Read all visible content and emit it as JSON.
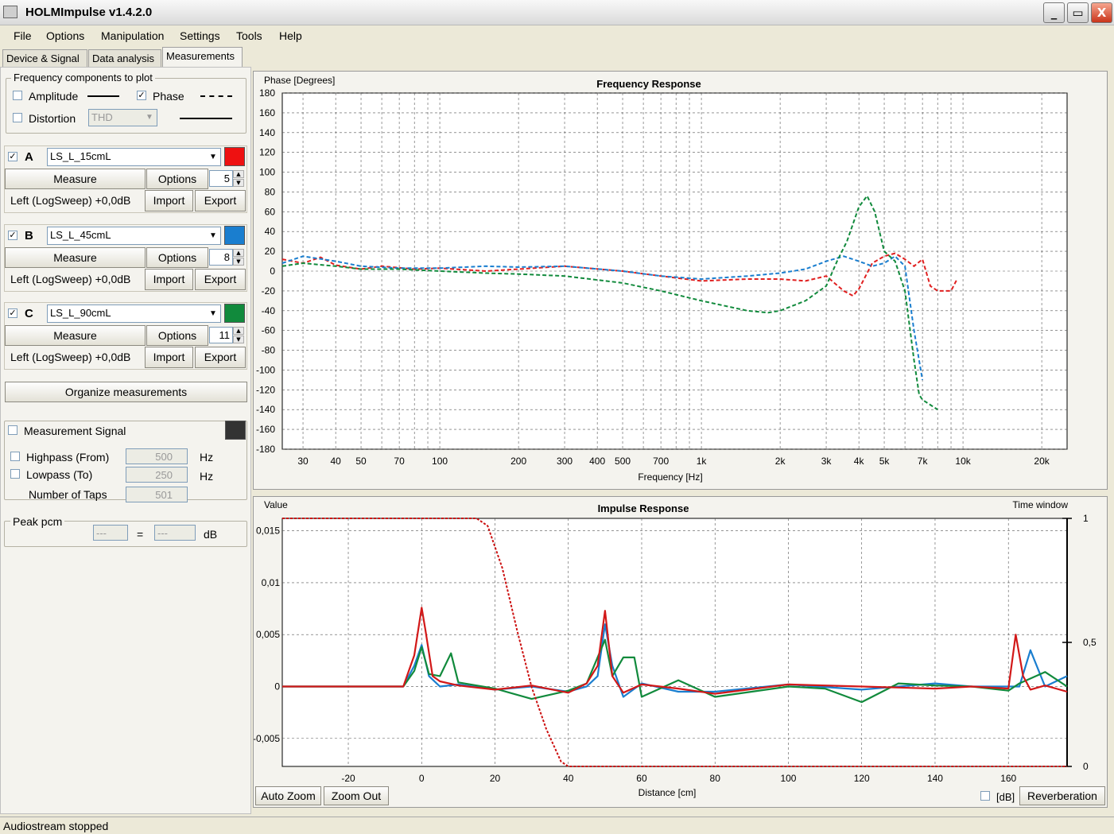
{
  "window": {
    "title": "HOLMImpulse  v1.4.2.0",
    "minimize": "_",
    "maximize": "▭",
    "close": "X"
  },
  "menu": [
    "File",
    "Options",
    "Manipulation",
    "Settings",
    "Tools",
    "Help"
  ],
  "tabs": [
    "Device & Signal",
    "Data analysis",
    "Measurements"
  ],
  "freq_components": {
    "title": "Frequency components to plot",
    "amplitude": "Amplitude",
    "amplitude_checked": false,
    "phase": "Phase",
    "phase_checked": true,
    "distortion": "Distortion",
    "distortion_checked": false,
    "distortion_select": "THD"
  },
  "measurements": [
    {
      "letter": "A",
      "checked": true,
      "name": "LS_L_15cmL",
      "color": "#ee1111",
      "measure": "Measure",
      "options": "Options",
      "spin": "5",
      "info": "Left (LogSweep) +0,0dB",
      "import": "Import",
      "export": "Export"
    },
    {
      "letter": "B",
      "checked": true,
      "name": "LS_L_45cmL",
      "color": "#1a7ecf",
      "measure": "Measure",
      "options": "Options",
      "spin": "8",
      "info": "Left (LogSweep) +0,0dB",
      "import": "Import",
      "export": "Export"
    },
    {
      "letter": "C",
      "checked": true,
      "name": "LS_L_90cmL",
      "color": "#118a3c",
      "measure": "Measure",
      "options": "Options",
      "spin": "11",
      "info": "Left (LogSweep) +0,0dB",
      "import": "Import",
      "export": "Export"
    }
  ],
  "organize": "Organize measurements",
  "signal": {
    "label": "Measurement Signal",
    "checked": false,
    "color": "#333333",
    "highpass": "Highpass (From)",
    "highpass_val": "500",
    "highpass_unit": "Hz",
    "lowpass": "Lowpass (To)",
    "lowpass_val": "250",
    "lowpass_unit": "Hz",
    "taps": "Number of Taps",
    "taps_val": "501"
  },
  "peak": {
    "title": "Peak pcm",
    "val1": "---",
    "eq": "=",
    "val2": "---",
    "unit": "dB"
  },
  "chart_data": [
    {
      "type": "line",
      "title": "Frequency Response",
      "ylabel": "Phase [Degrees]",
      "xlabel": "Frequency [Hz]",
      "xscale": "log",
      "xlim": [
        25,
        25000
      ],
      "ylim": [
        -180,
        180
      ],
      "yticks": [
        180,
        160,
        140,
        120,
        100,
        80,
        60,
        40,
        20,
        0,
        -20,
        -40,
        -60,
        -80,
        -100,
        -120,
        -140,
        -160,
        -180
      ],
      "xticks": [
        [
          30,
          "30"
        ],
        [
          40,
          "40"
        ],
        [
          50,
          "50"
        ],
        [
          70,
          "70"
        ],
        [
          100,
          "100"
        ],
        [
          200,
          "200"
        ],
        [
          300,
          "300"
        ],
        [
          400,
          "400"
        ],
        [
          500,
          "500"
        ],
        [
          700,
          "700"
        ],
        [
          1000,
          "1k"
        ],
        [
          2000,
          "2k"
        ],
        [
          3000,
          "3k"
        ],
        [
          4000,
          "4k"
        ],
        [
          5000,
          "5k"
        ],
        [
          7000,
          "7k"
        ],
        [
          10000,
          "10k"
        ],
        [
          20000,
          "20k"
        ]
      ],
      "grid": true,
      "series": [
        {
          "color": "#e02020",
          "dash": "dashed",
          "x": [
            25,
            30,
            35,
            40,
            50,
            60,
            80,
            100,
            150,
            200,
            300,
            500,
            700,
            1000,
            1500,
            2000,
            2500,
            3000,
            3500,
            3800,
            4000,
            4500,
            5000,
            5500,
            6000,
            6500,
            7000,
            7500,
            8000,
            9000,
            9500
          ],
          "y": [
            12,
            8,
            14,
            6,
            2,
            5,
            2,
            3,
            0,
            2,
            5,
            0,
            -5,
            -10,
            -8,
            -8,
            -10,
            -5,
            -20,
            -25,
            -18,
            8,
            15,
            18,
            12,
            5,
            12,
            -15,
            -20,
            -20,
            -8
          ]
        },
        {
          "color": "#1a7ecf",
          "dash": "dashed",
          "x": [
            25,
            30,
            40,
            50,
            70,
            100,
            150,
            200,
            300,
            500,
            700,
            1000,
            1500,
            2000,
            2500,
            3000,
            3500,
            4000,
            4500,
            5000,
            5500,
            6000,
            6500,
            7000
          ],
          "y": [
            8,
            15,
            10,
            5,
            3,
            3,
            5,
            4,
            5,
            0,
            -5,
            -8,
            -5,
            -2,
            2,
            10,
            15,
            10,
            5,
            8,
            15,
            5,
            -60,
            -110
          ]
        },
        {
          "color": "#118a3c",
          "dash": "dashed",
          "x": [
            25,
            30,
            40,
            50,
            70,
            100,
            150,
            200,
            300,
            500,
            700,
            1000,
            1500,
            1800,
            2000,
            2500,
            3000,
            3300,
            3600,
            4000,
            4300,
            4600,
            5000,
            5500,
            6000,
            6500,
            6800,
            7000,
            8000
          ],
          "y": [
            5,
            8,
            5,
            2,
            2,
            0,
            -2,
            -3,
            -5,
            -12,
            -20,
            -30,
            -40,
            -42,
            -40,
            -30,
            -15,
            10,
            30,
            65,
            76,
            60,
            20,
            10,
            -20,
            -90,
            -125,
            -130,
            -140
          ]
        }
      ]
    },
    {
      "type": "line",
      "title": "Impulse Response",
      "ylabel": "Value",
      "y2label": "Time window",
      "xlabel": "Distance [cm]",
      "xlim": [
        -38,
        176
      ],
      "ylim": [
        -0.0077,
        0.0162
      ],
      "yticks": [
        [
          0.015,
          "0,015"
        ],
        [
          0.01,
          "0,01"
        ],
        [
          0.005,
          "0,005"
        ],
        [
          0,
          "0"
        ],
        [
          -0.005,
          "-0,005"
        ]
      ],
      "y2ticks": [
        [
          1,
          "1"
        ],
        [
          0.5,
          "0,5"
        ],
        [
          0,
          "0"
        ]
      ],
      "xticks": [
        [
          -20,
          "-20"
        ],
        [
          0,
          "0"
        ],
        [
          20,
          "20"
        ],
        [
          40,
          "40"
        ],
        [
          60,
          "60"
        ],
        [
          80,
          "80"
        ],
        [
          100,
          "100"
        ],
        [
          120,
          "120"
        ],
        [
          140,
          "140"
        ],
        [
          160,
          "160"
        ]
      ],
      "grid": true,
      "series": [
        {
          "color": "#1a7ecf",
          "x": [
            -38,
            -5,
            -2,
            0,
            2,
            5,
            10,
            20,
            30,
            40,
            45,
            48,
            50,
            52,
            55,
            60,
            70,
            80,
            100,
            120,
            140,
            150,
            160,
            163,
            166,
            170,
            176
          ],
          "y": [
            0,
            0,
            0.002,
            0.004,
            0.001,
            0,
            0.0002,
            -0.0003,
            0,
            -0.0005,
            0,
            0.001,
            0.006,
            0.002,
            -0.001,
            0.0003,
            -0.0005,
            -0.0005,
            0.0002,
            -0.0003,
            0.0003,
            0,
            0,
            0,
            0.0035,
            0,
            0.001
          ]
        },
        {
          "color": "#118a3c",
          "x": [
            -38,
            -5,
            -2,
            0,
            2,
            5,
            8,
            10,
            20,
            30,
            40,
            45,
            50,
            52,
            55,
            58,
            60,
            70,
            80,
            90,
            100,
            110,
            120,
            130,
            140,
            150,
            160,
            163,
            170,
            176
          ],
          "y": [
            0,
            0,
            0.0015,
            0.0038,
            0.0012,
            0.001,
            0.0032,
            0.0004,
            -0.0002,
            -0.0012,
            -0.0004,
            0.0003,
            0.0045,
            0.001,
            0.0028,
            0.0028,
            -0.001,
            0.0006,
            -0.001,
            -0.0005,
            0,
            -0.0002,
            -0.0015,
            0.0003,
            0.0001,
            0,
            -0.0004,
            0.0003,
            0.0014,
            0
          ]
        },
        {
          "color": "#d21818",
          "x": [
            -38,
            -5,
            -2,
            0,
            1,
            3,
            5,
            10,
            20,
            30,
            40,
            45,
            48,
            50,
            52,
            55,
            60,
            70,
            80,
            100,
            120,
            140,
            150,
            160,
            162,
            164,
            166,
            170,
            176
          ],
          "y": [
            0,
            0,
            0.003,
            0.0076,
            0.0055,
            0.001,
            0.0005,
            0.0001,
            -0.0003,
            0.0001,
            -0.0006,
            0.0003,
            0.002,
            0.0073,
            0.001,
            -0.0006,
            0.0002,
            -0.0002,
            -0.0007,
            0.0002,
            0,
            -0.0002,
            0,
            -0.0002,
            0.005,
            0.001,
            -0.0003,
            0.0001,
            -0.0005
          ]
        },
        {
          "color": "#cc1010",
          "dash": "dotted",
          "axis": "y2",
          "x": [
            -38,
            15,
            18,
            22,
            26,
            30,
            34,
            38,
            40,
            176
          ],
          "y": [
            1,
            1,
            0.97,
            0.8,
            0.55,
            0.32,
            0.15,
            0.02,
            0,
            0
          ]
        }
      ]
    }
  ],
  "ir_buttons": {
    "auto_zoom": "Auto Zoom",
    "zoom_out": "Zoom Out",
    "db_label": "[dB]",
    "reverberation": "Reverberation"
  },
  "status": "Audiostream stopped"
}
